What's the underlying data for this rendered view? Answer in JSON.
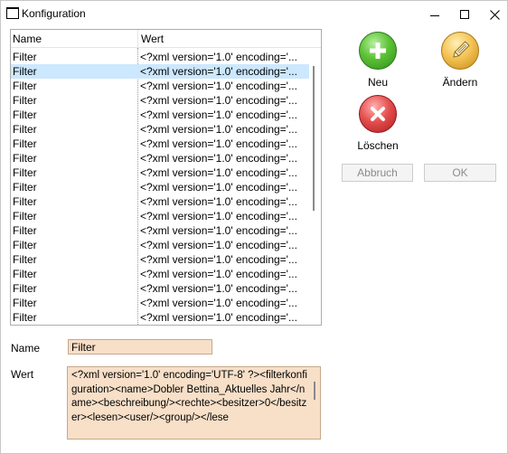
{
  "window": {
    "title": "Konfiguration"
  },
  "list": {
    "columns": [
      "Name",
      "Wert"
    ],
    "rows": [
      {
        "name": "Filter",
        "value": "<?xml version='1.0' encoding='...",
        "selected": false
      },
      {
        "name": "Filter",
        "value": "<?xml version='1.0' encoding='...",
        "selected": true
      },
      {
        "name": "Filter",
        "value": "<?xml version='1.0' encoding='...",
        "selected": false
      },
      {
        "name": "Filter",
        "value": "<?xml version='1.0' encoding='...",
        "selected": false
      },
      {
        "name": "Filter",
        "value": "<?xml version='1.0' encoding='...",
        "selected": false
      },
      {
        "name": "Filter",
        "value": "<?xml version='1.0' encoding='...",
        "selected": false
      },
      {
        "name": "Filter",
        "value": "<?xml version='1.0' encoding='...",
        "selected": false
      },
      {
        "name": "Filter",
        "value": "<?xml version='1.0' encoding='...",
        "selected": false
      },
      {
        "name": "Filter",
        "value": "<?xml version='1.0' encoding='...",
        "selected": false
      },
      {
        "name": "Filter",
        "value": "<?xml version='1.0' encoding='...",
        "selected": false
      },
      {
        "name": "Filter",
        "value": "<?xml version='1.0' encoding='...",
        "selected": false
      },
      {
        "name": "Filter",
        "value": "<?xml version='1.0' encoding='...",
        "selected": false
      },
      {
        "name": "Filter",
        "value": "<?xml version='1.0' encoding='...",
        "selected": false
      },
      {
        "name": "Filter",
        "value": "<?xml version='1.0' encoding='...",
        "selected": false
      },
      {
        "name": "Filter",
        "value": "<?xml version='1.0' encoding='...",
        "selected": false
      },
      {
        "name": "Filter",
        "value": "<?xml version='1.0' encoding='...",
        "selected": false
      },
      {
        "name": "Filter",
        "value": "<?xml version='1.0' encoding='...",
        "selected": false
      },
      {
        "name": "Filter",
        "value": "<?xml version='1.0' encoding='...",
        "selected": false
      },
      {
        "name": "Filter",
        "value": "<?xml version='1.0' encoding='...",
        "selected": false
      },
      {
        "name": "Filter",
        "value": "<?xml version='1.0' encoding='...",
        "selected": false
      }
    ]
  },
  "actions": {
    "new_label": "Neu",
    "edit_label": "Ändern",
    "delete_label": "Löschen",
    "cancel_label": "Abbruch",
    "ok_label": "OK"
  },
  "form": {
    "name_label": "Name",
    "name_value": "Filter",
    "value_label": "Wert",
    "value_text": "<?xml version='1.0' encoding='UTF-8' ?><filterkonfiguration><name>Dobler Bettina_Aktuelles Jahr</name><beschreibung/><rechte><besitzer>0</besitzer><lesen><user/><group/></lese"
  },
  "icons": {
    "new": "plus-icon",
    "edit": "pencil-icon",
    "delete": "x-icon"
  },
  "colors": {
    "selection": "#cce8ff",
    "field_background": "#f7dfc8",
    "new_green": "#5cc235",
    "edit_orange": "#f3c357",
    "delete_red": "#e4504f"
  }
}
